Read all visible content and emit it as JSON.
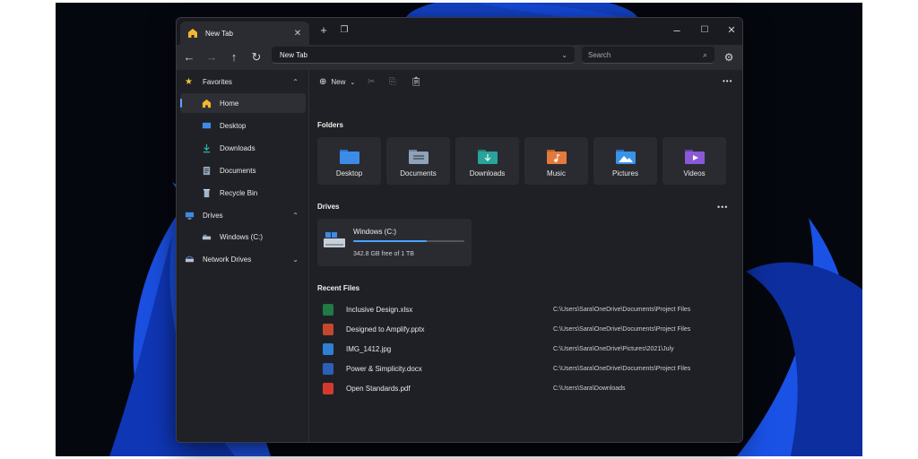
{
  "tab": {
    "title": "New Tab"
  },
  "nav": {
    "address": "New Tab",
    "search_placeholder": "Search"
  },
  "toolbar": {
    "new_label": "New"
  },
  "sidebar": {
    "items": [
      {
        "label": "Favorites",
        "icon": "star-icon",
        "expandable": true
      },
      {
        "label": "Home",
        "icon": "home-icon",
        "active": true
      },
      {
        "label": "Desktop",
        "icon": "desktop-icon"
      },
      {
        "label": "Downloads",
        "icon": "download-icon"
      },
      {
        "label": "Documents",
        "icon": "document-icon"
      },
      {
        "label": "Recycle Bin",
        "icon": "recycle-bin-icon"
      },
      {
        "label": "Drives",
        "icon": "monitor-icon",
        "expandable": true
      },
      {
        "label": "Windows (C:)",
        "icon": "drive-icon"
      },
      {
        "label": "Network Drives",
        "icon": "network-drive-icon",
        "expandable": true
      }
    ]
  },
  "sections": {
    "folders": "Folders",
    "drives": "Drives",
    "recent": "Recent Files"
  },
  "folders": [
    {
      "label": "Desktop",
      "icon": "desktop-folder-icon",
      "color": "#3c8ce7"
    },
    {
      "label": "Documents",
      "icon": "documents-folder-icon",
      "color": "#8fa3b8"
    },
    {
      "label": "Downloads",
      "icon": "downloads-folder-icon",
      "color": "#2aa39a"
    },
    {
      "label": "Music",
      "icon": "music-folder-icon",
      "color": "#e37a3c"
    },
    {
      "label": "Pictures",
      "icon": "pictures-folder-icon",
      "color": "#3a93e6"
    },
    {
      "label": "Videos",
      "icon": "videos-folder-icon",
      "color": "#8a5ad6"
    }
  ],
  "drive": {
    "name": "Windows (C:)",
    "free_text": "342.8 GB free of 1 TB",
    "used_fraction": 0.66,
    "accent": "#4aa0ff"
  },
  "recent_files": [
    {
      "name": "Inclusive Design.xlsx",
      "path": "C:\\Users\\Sara\\OneDrive\\Documents\\Project Files",
      "icon": "excel-file-icon",
      "color": "#1f7a45"
    },
    {
      "name": "Designed to Amplify.pptx",
      "path": "C:\\Users\\Sara\\OneDrive\\Documents\\Project Files",
      "icon": "powerpoint-file-icon",
      "color": "#c7472c"
    },
    {
      "name": "IMG_1412.jpg",
      "path": "C:\\Users\\Sara\\OneDrive\\Pictures\\2021\\July",
      "icon": "image-file-icon",
      "color": "#2f7fd6"
    },
    {
      "name": "Power & Simplicity.docx",
      "path": "C:\\Users\\Sara\\OneDrive\\Documents\\Project Files",
      "icon": "word-file-icon",
      "color": "#2b5fb8"
    },
    {
      "name": "Open Standards.pdf",
      "path": "C:\\Users\\Sara\\Downloads",
      "icon": "pdf-file-icon",
      "color": "#d23a2e"
    }
  ]
}
